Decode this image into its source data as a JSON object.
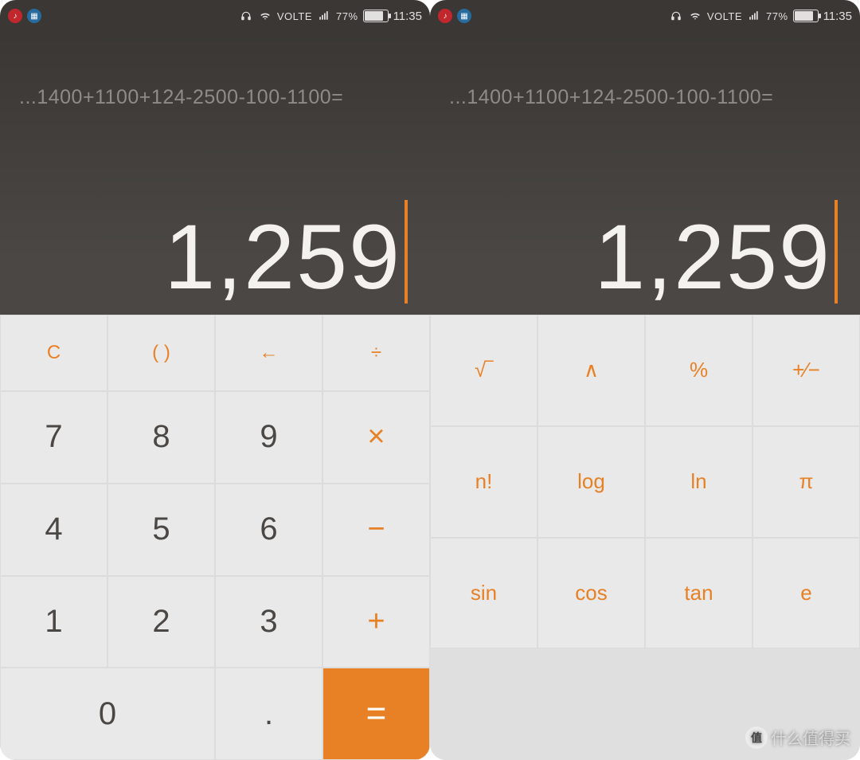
{
  "statusbar": {
    "volte": "VOLTE",
    "battery_pct": "77%",
    "clock": "11:35"
  },
  "display": {
    "expression": "...1400+1100+124-2500-100-1100=",
    "result": "1,259"
  },
  "basic": {
    "clear": "C",
    "paren": "( )",
    "back": "←",
    "div": "÷",
    "n7": "7",
    "n8": "8",
    "n9": "9",
    "mul": "×",
    "n4": "4",
    "n5": "5",
    "n6": "6",
    "sub": "−",
    "n1": "1",
    "n2": "2",
    "n3": "3",
    "add": "+",
    "n0": "0",
    "dot": ".",
    "eq": "="
  },
  "sci": {
    "sqrt": "√‾",
    "pow": "∧",
    "pct": "%",
    "pm": "+⁄−",
    "fact": "n!",
    "log": "log",
    "ln": "ln",
    "pi": "π",
    "sin": "sin",
    "cos": "cos",
    "tan": "tan",
    "e": "e"
  },
  "watermark": {
    "badge": "值",
    "text": "什么值得买"
  }
}
